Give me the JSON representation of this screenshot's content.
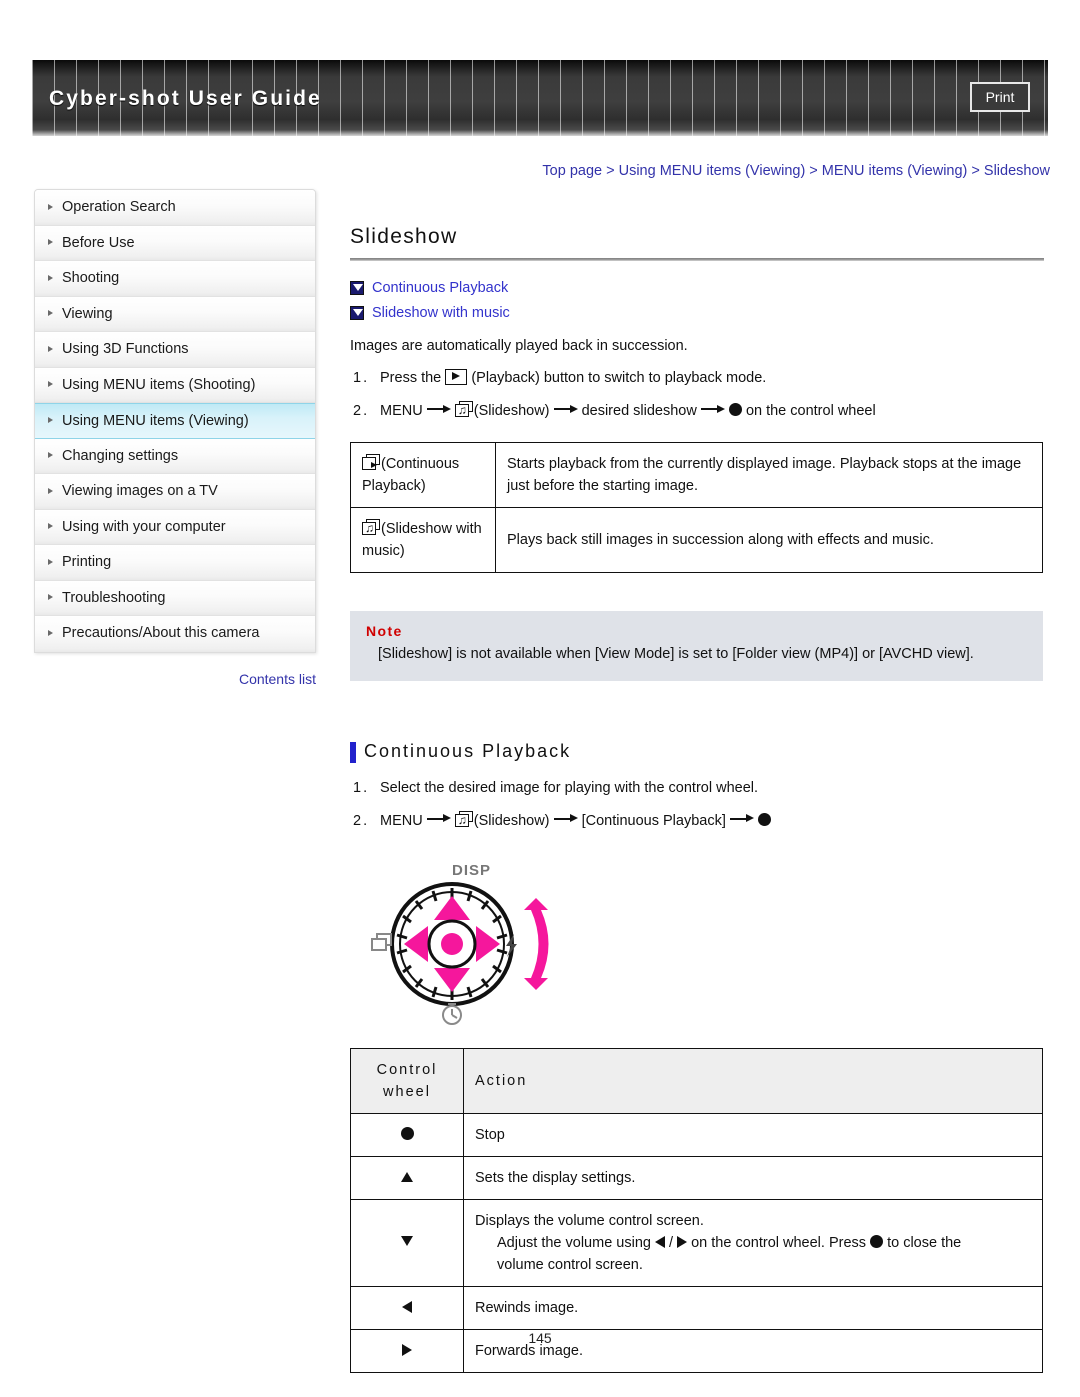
{
  "header": {
    "title": "Cyber-shot User Guide",
    "print_label": "Print"
  },
  "breadcrumb": "Top page > Using MENU items (Viewing) > MENU items (Viewing) > Slideshow",
  "sidebar": {
    "items": [
      {
        "label": "Operation Search",
        "active": false
      },
      {
        "label": "Before Use",
        "active": false
      },
      {
        "label": "Shooting",
        "active": false
      },
      {
        "label": "Viewing",
        "active": false
      },
      {
        "label": "Using 3D Functions",
        "active": false
      },
      {
        "label": "Using MENU items (Shooting)",
        "active": false
      },
      {
        "label": "Using MENU items (Viewing)",
        "active": true
      },
      {
        "label": "Changing settings",
        "active": false
      },
      {
        "label": "Viewing images on a TV",
        "active": false
      },
      {
        "label": "Using with your computer",
        "active": false
      },
      {
        "label": "Printing",
        "active": false
      },
      {
        "label": "Troubleshooting",
        "active": false
      },
      {
        "label": "Precautions/About this camera",
        "active": false
      }
    ],
    "contents_link": "Contents list"
  },
  "main": {
    "title": "Slideshow",
    "jump_links": [
      "Continuous Playback",
      "Slideshow with music"
    ],
    "intro": "Images are automatically played back in succession.",
    "steps": [
      {
        "num": "1.",
        "before_icon": "Press the",
        "icon": "playback-icon",
        "after_icon": "(Playback) button to switch to playback mode."
      },
      {
        "num": "2.",
        "menu": "MENU",
        "icon": "slideshow-icon",
        "icon_label": "(Slideshow)",
        "mid": "desired slideshow",
        "tail": "on the control wheel"
      }
    ],
    "desc_table": {
      "rows": [
        {
          "icon": "continuous-playback-icon",
          "key": "(Continuous Playback)",
          "value": "Starts playback from the currently displayed image. Playback stops at the image just before the starting image."
        },
        {
          "icon": "slideshow-with-music-icon",
          "key": "(Slideshow with music)",
          "value": "Plays back still images in succession along with effects and music."
        }
      ]
    },
    "note": {
      "title": "Note",
      "body": "[Slideshow] is not available when [View Mode] is set to [Folder view (MP4)] or [AVCHD view]."
    },
    "section": {
      "title": "Continuous Playback",
      "steps": [
        {
          "num": "1.",
          "text": "Select the desired image for playing with the control wheel."
        },
        {
          "num": "2.",
          "menu": "MENU",
          "icon": "slideshow-icon",
          "icon_label": "(Slideshow)",
          "mid": "[Continuous Playback]"
        }
      ],
      "wheel_figure": {
        "disp_label": "DISP",
        "left_icon": "image-index-icon",
        "right_icon": "flash-icon",
        "bottom_icon": "self-timer-icon",
        "accent_color": "#f5179c"
      },
      "wheel_table": {
        "headers": [
          "Control wheel",
          "Action"
        ],
        "header_line1": "Control",
        "header_line2": "wheel",
        "rows": [
          {
            "control": "center-button",
            "action": "Stop"
          },
          {
            "control": "up-button",
            "action": "Sets the display settings."
          },
          {
            "control": "down-button",
            "action_line1": "Displays the volume control screen.",
            "action_line2_a": "Adjust the volume using",
            "action_line2_b": "/",
            "action_line2_c": "on the control wheel. Press",
            "action_line2_d": "to close the",
            "action_line3": "volume control screen."
          },
          {
            "control": "left-button",
            "action": "Rewinds image."
          },
          {
            "control": "right-button",
            "action": "Forwards image."
          }
        ]
      }
    }
  },
  "page_number": "145",
  "colors": {
    "link": "#3333cc",
    "breadcrumb": "#3333aa",
    "note_title": "#d00000",
    "note_bg": "#dfe2e8",
    "active_nav": "#bfe9f5",
    "accent_bar": "#2222cc"
  }
}
